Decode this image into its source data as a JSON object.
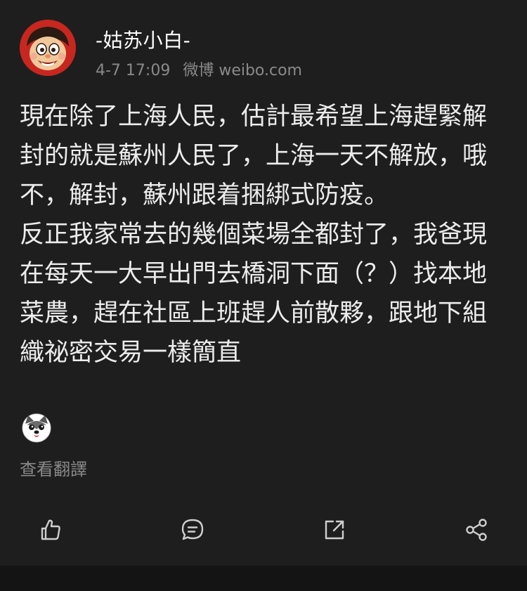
{
  "user": {
    "name": "-姑苏小白-",
    "avatar_icon": "cartoon-boy-avatar"
  },
  "post_meta": {
    "time": "4-7 17:09",
    "source": "微博 weibo.com"
  },
  "post": {
    "text": "現在除了上海人民，估計最希望上海趕緊解封的就是蘇州人民了，上海一天不解放，哦不，解封，蘇州跟着捆綁式防疫。\n反正我家常去的幾個菜場全都封了，我爸現在每天一大早出門去橋洞下面（？）找本地菜農，趕在社區上班趕人前散夥，跟地下組織祕密交易一樣簡直",
    "trailing_emoji": "husky-dog-emoji"
  },
  "translate_label": "查看翻譯",
  "actions": [
    {
      "name": "like",
      "icon": "thumbs-up-icon"
    },
    {
      "name": "comment",
      "icon": "comment-bubble-icon"
    },
    {
      "name": "forward",
      "icon": "forward-arrow-icon"
    },
    {
      "name": "share",
      "icon": "share-icon"
    }
  ],
  "colors": {
    "background": "#1e1e1e",
    "text": "#ececec",
    "muted": "#8a8a8a",
    "avatar_red": "#c7271f"
  }
}
